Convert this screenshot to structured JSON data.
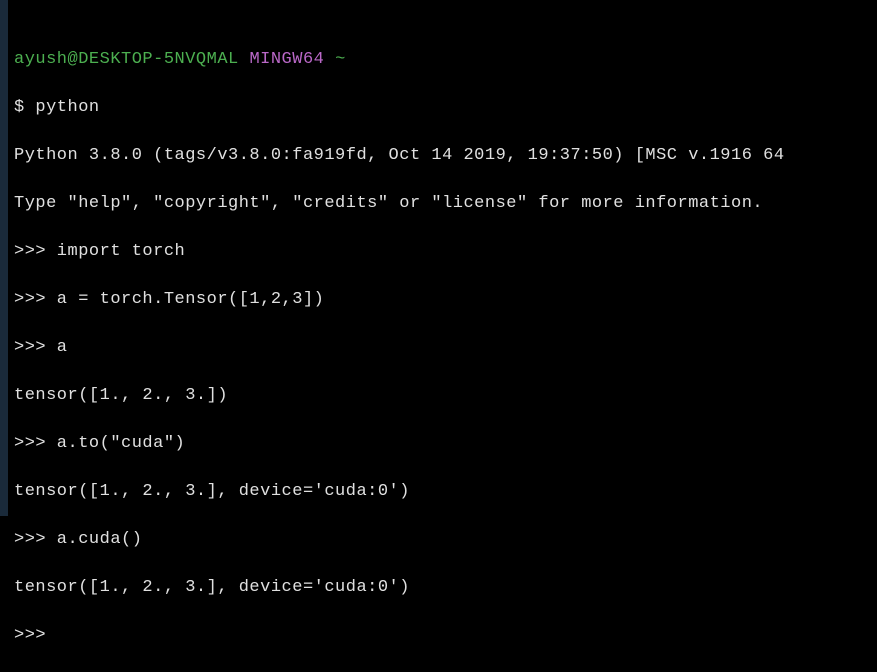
{
  "prompt": {
    "user_host": "ayush@DESKTOP-5NVQMAL",
    "env": "MINGW64",
    "path": "~"
  },
  "lines": {
    "cmd1": "$ python",
    "out1": "Python 3.8.0 (tags/v3.8.0:fa919fd, Oct 14 2019, 19:37:50) [MSC v.1916 64",
    "out2": "Type \"help\", \"copyright\", \"credits\" or \"license\" for more information.",
    "repl1": ">>> import torch",
    "repl2": ">>> a = torch.Tensor([1,2,3])",
    "repl3": ">>> a",
    "out3": "tensor([1., 2., 3.])",
    "repl4": ">>> a.to(\"cuda\")",
    "out4": "tensor([1., 2., 3.], device='cuda:0')",
    "repl5": ">>> a.cuda()",
    "out5": "tensor([1., 2., 3.], device='cuda:0')",
    "repl6": ">>> "
  }
}
